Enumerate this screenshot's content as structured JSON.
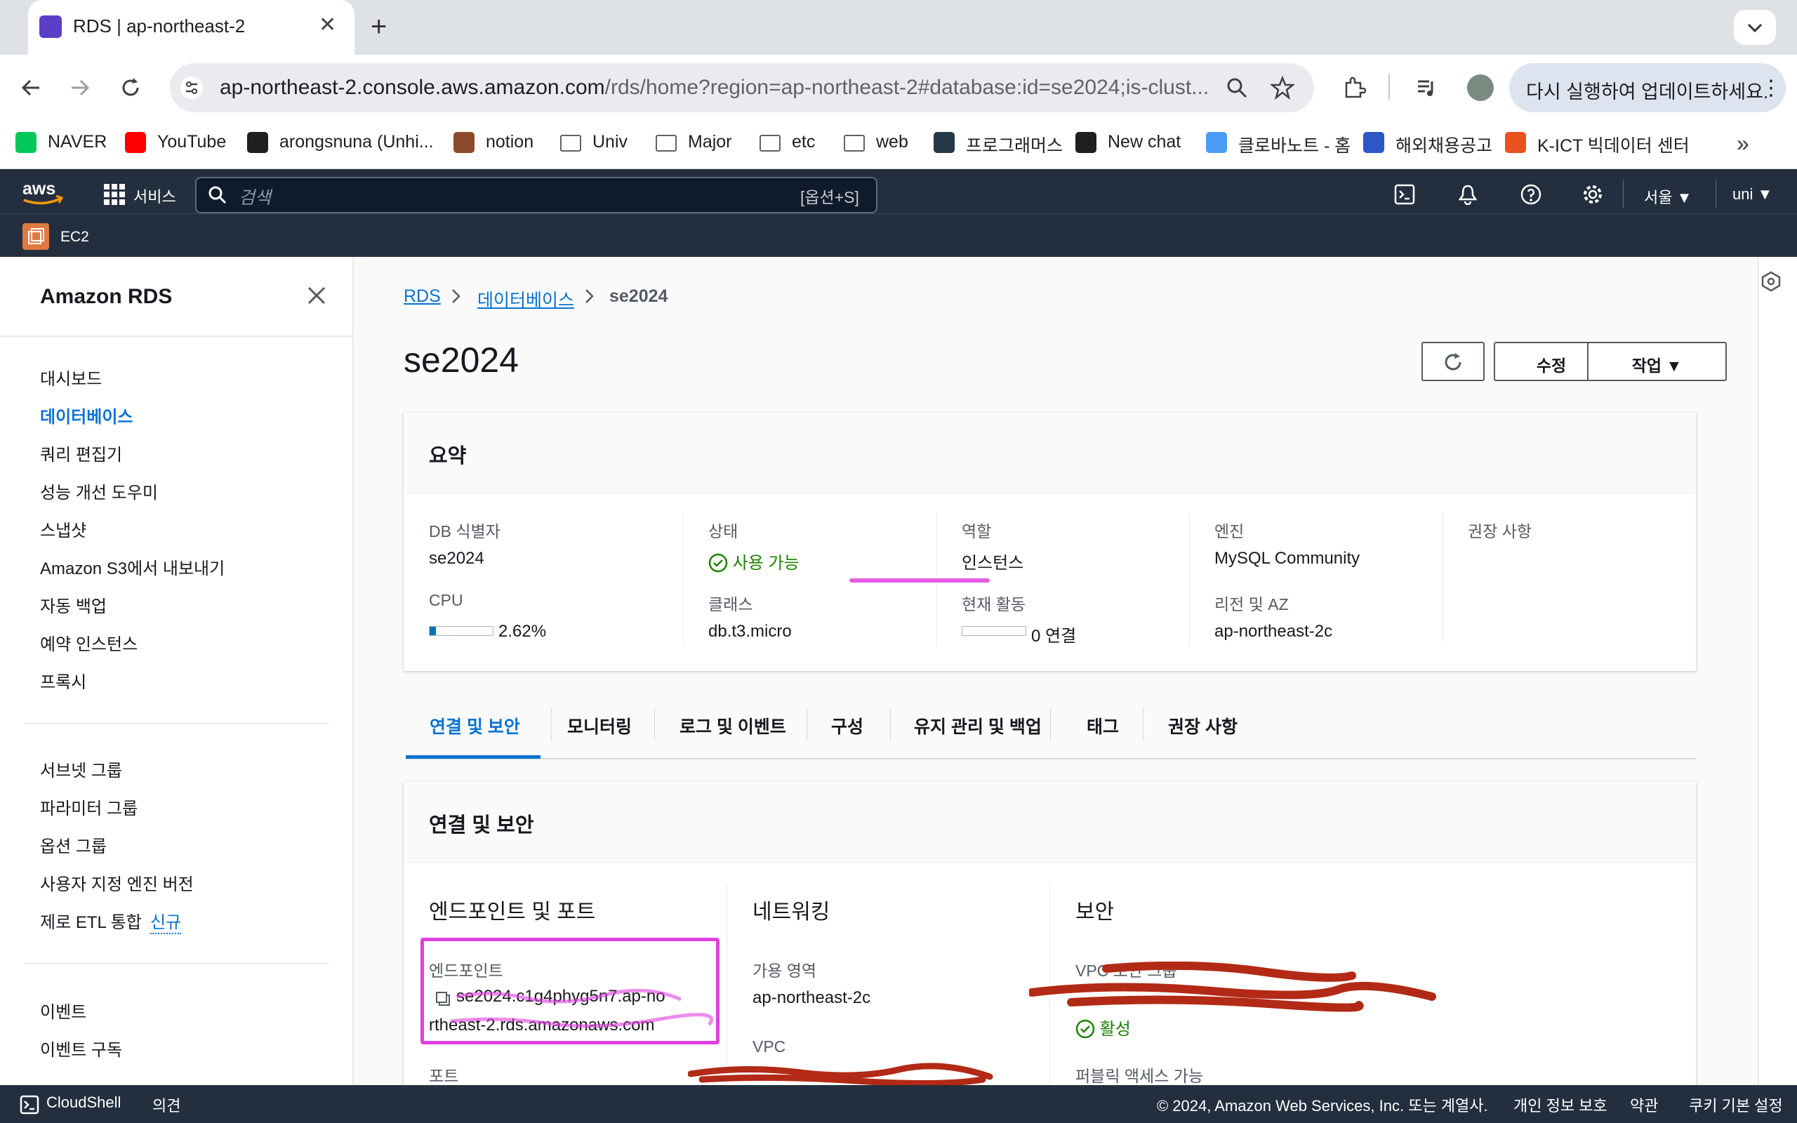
{
  "browser": {
    "tab_title": "RDS | ap-northeast-2",
    "url_host": "ap-northeast-2.console.aws.amazon.com",
    "url_path": "/rds/home?region=ap-northeast-2#database:id=se2024;is-clust...",
    "update_button": "다시 실행하여 업데이트하세요.",
    "bookmarks": [
      {
        "label": "NAVER",
        "icon": "naver-icon",
        "color": "#03c75a"
      },
      {
        "label": "YouTube",
        "icon": "youtube-icon",
        "color": "#ff0000"
      },
      {
        "label": "arongsnuna (Unhi...",
        "icon": "github-icon",
        "color": "#1f1f1f"
      },
      {
        "label": "notion",
        "icon": "notion-icon",
        "color": "#8b4a2b"
      },
      {
        "label": "Univ",
        "icon": "folder-icon",
        "color": "#5f6368"
      },
      {
        "label": "Major",
        "icon": "folder-icon",
        "color": "#5f6368"
      },
      {
        "label": "etc",
        "icon": "folder-icon",
        "color": "#5f6368"
      },
      {
        "label": "web",
        "icon": "folder-icon",
        "color": "#5f6368"
      },
      {
        "label": "프로그래머스",
        "icon": "programmers-icon",
        "color": "#263747"
      },
      {
        "label": "New chat",
        "icon": "openai-icon",
        "color": "#1f1f1f"
      },
      {
        "label": "클로바노트 - 홈",
        "icon": "clova-icon",
        "color": "#4c9bf5"
      },
      {
        "label": "해외채용공고",
        "icon": "globe-icon",
        "color": "#2d56c6"
      },
      {
        "label": "K-ICT 빅데이터 센터",
        "icon": "kict-icon",
        "color": "#e8521e"
      }
    ]
  },
  "aws_header": {
    "services": "서비스",
    "search_placeholder": "검색",
    "search_shortcut": "[옵션+S]",
    "region": "서울",
    "user": "uni",
    "favorite": "EC2"
  },
  "sidebar": {
    "title": "Amazon RDS",
    "group1": [
      "대시보드",
      "데이터베이스",
      "쿼리 편집기",
      "성능 개선 도우미",
      "스냅샷",
      "Amazon S3에서 내보내기",
      "자동 백업",
      "예약 인스턴스",
      "프록시"
    ],
    "group2": [
      "서브넷 그룹",
      "파라미터 그룹",
      "옵션 그룹",
      "사용자 지정 엔진 버전",
      "제로 ETL 통합"
    ],
    "new_badge": "신규",
    "group3": [
      "이벤트",
      "이벤트 구독"
    ],
    "active": "데이터베이스"
  },
  "breadcrumb": {
    "root": "RDS",
    "section": "데이터베이스",
    "current": "se2024"
  },
  "page_title": "se2024",
  "actions": {
    "modify": "수정",
    "actions": "작업"
  },
  "summary": {
    "title": "요약",
    "db_id_label": "DB 식별자",
    "db_id": "se2024",
    "cpu_label": "CPU",
    "cpu": "2.62%",
    "cpu_fraction": 0.0262,
    "status_label": "상태",
    "status": "사용 가능",
    "class_label": "클래스",
    "class": "db.t3.micro",
    "role_label": "역할",
    "role": "인스턴스",
    "activity_label": "현재 활동",
    "activity": "0 연결",
    "engine_label": "엔진",
    "engine": "MySQL Community",
    "region_label": "리전 및 AZ",
    "region": "ap-northeast-2c",
    "recommend_label": "권장 사항"
  },
  "tabs": [
    "연결 및 보안",
    "모니터링",
    "로그 및 이벤트",
    "구성",
    "유지 관리 및 백업",
    "태그",
    "권장 사항"
  ],
  "conn": {
    "title": "연결 및 보안",
    "endpoint_head": "엔드포인트 및 포트",
    "endpoint_label": "엔드포인트",
    "endpoint_line1": "se2024.c1g4phyg5n7.ap-no",
    "endpoint_line2": "rtheast-2.rds.amazonaws.com",
    "port_label": "포트",
    "network_head": "네트워킹",
    "az_label": "가용 영역",
    "az": "ap-northeast-2c",
    "vpc_label": "VPC",
    "security_head": "보안",
    "sg_label": "VPC 보안 그룹",
    "sg_status": "활성",
    "public_label": "퍼블릭 액세스 가능"
  },
  "footer": {
    "cloudshell": "CloudShell",
    "feedback": "의견",
    "copyright": "© 2024, Amazon Web Services, Inc. 또는 계열사.",
    "privacy": "개인 정보 보호",
    "terms": "약관",
    "cookies": "쿠키 기본 설정"
  }
}
